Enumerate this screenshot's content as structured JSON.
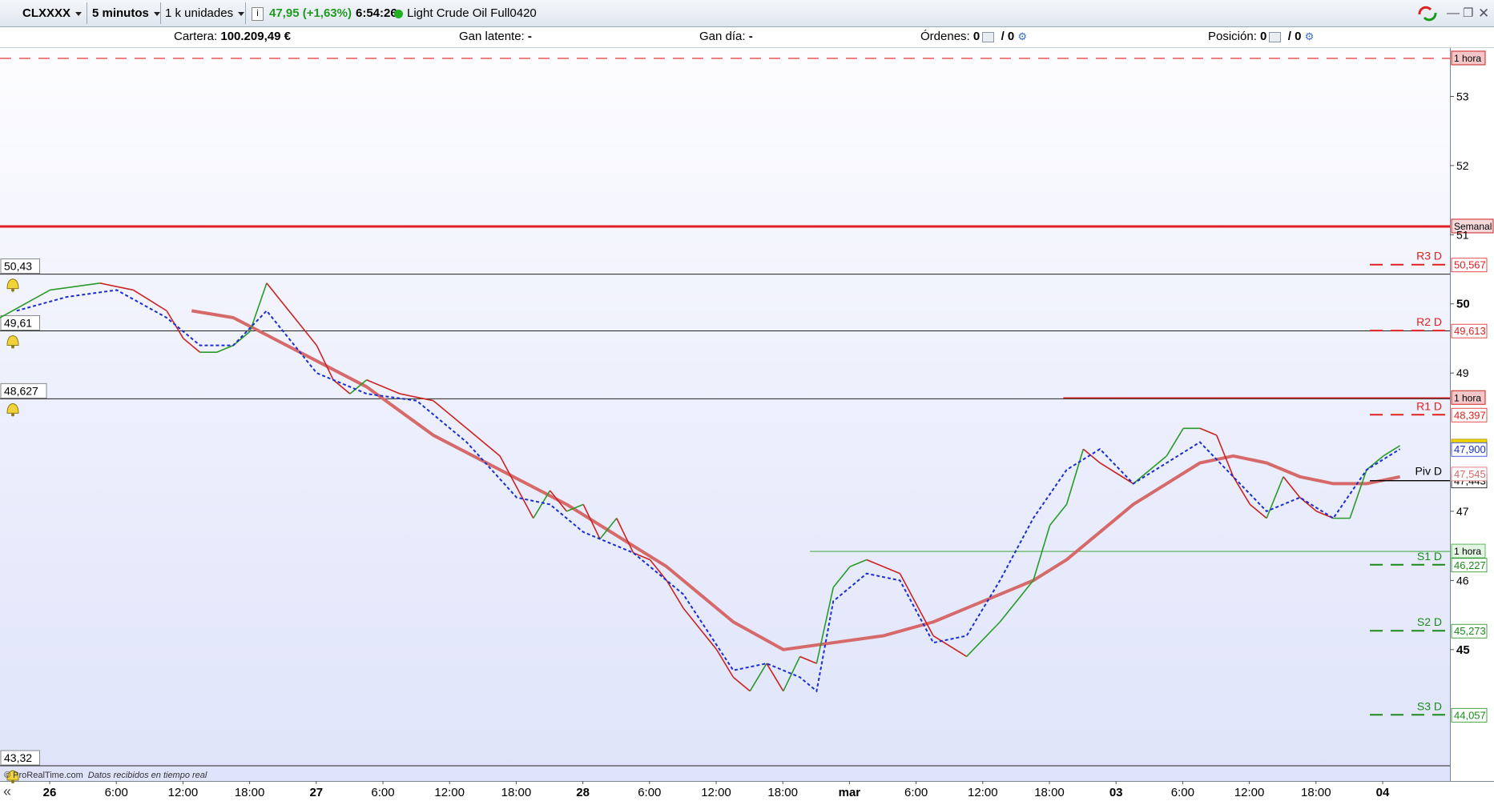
{
  "toolbar": {
    "symbol": "CLXXXX",
    "timeframe": "5 minutos",
    "units": "1 k unidades",
    "price_change": "47,95 (+1,63%)",
    "time": "6:54:26",
    "instrument": "Light Crude Oil Full0420"
  },
  "infobar": {
    "cartera_label": "Cartera:",
    "cartera_value": "100.209,49 €",
    "gan_latente_label": "Gan latente:",
    "gan_latente_value": "-",
    "gan_dia_label": "Gan día:",
    "gan_dia_value": "-",
    "ordenes_label": "Órdenes:",
    "ordenes_a": "0",
    "ordenes_b": "/ 0",
    "posicion_label": "Posición:",
    "posicion_a": "0",
    "posicion_b": "/ 0"
  },
  "footer": {
    "credit": "© ProRealTime.com",
    "credit_note": "Datos recibidos en tiempo real"
  },
  "colors": {
    "accent_red": "#e02020",
    "ma_color": "#d66a6a",
    "green": "#2a9a2a",
    "blue_dotted": "#1a2fd0",
    "last_price_bg": "#f2d600"
  },
  "chart_data": {
    "type": "line",
    "ylim": [
      43.1,
      53.7
    ],
    "y_ticks": [
      "53",
      "52",
      "51",
      "50",
      "49",
      "47",
      "46",
      "45"
    ],
    "x_ticks": [
      "26",
      "6:00",
      "12:00",
      "18:00",
      "27",
      "6:00",
      "12:00",
      "18:00",
      "28",
      "6:00",
      "12:00",
      "18:00",
      "mar",
      "6:00",
      "12:00",
      "18:00",
      "03",
      "6:00",
      "12:00",
      "18:00",
      "04"
    ],
    "price": {
      "x": [
        0,
        3,
        6,
        8,
        10,
        11,
        12,
        13,
        14,
        15,
        16,
        18,
        19,
        20,
        21,
        22,
        24,
        26,
        28,
        30,
        32,
        33,
        34,
        35,
        36,
        37,
        38,
        39,
        40,
        41,
        42,
        43,
        44,
        45,
        46,
        47,
        48,
        49,
        50,
        51,
        52,
        54,
        56,
        58,
        60,
        62,
        63,
        64,
        65,
        66,
        68,
        69,
        70,
        71,
        72,
        73,
        74,
        75,
        76,
        77,
        78,
        79,
        80,
        81,
        82,
        83,
        84
      ],
      "y": [
        49.8,
        50.2,
        50.3,
        50.2,
        49.9,
        49.5,
        49.3,
        49.3,
        49.4,
        49.6,
        50.3,
        49.7,
        49.4,
        48.9,
        48.7,
        48.9,
        48.7,
        48.6,
        48.2,
        47.8,
        46.9,
        47.3,
        47.0,
        47.1,
        46.6,
        46.9,
        46.4,
        46.3,
        46.0,
        45.6,
        45.3,
        45.0,
        44.6,
        44.4,
        44.8,
        44.4,
        44.9,
        44.8,
        45.9,
        46.2,
        46.3,
        46.1,
        45.2,
        44.9,
        45.4,
        46.0,
        46.8,
        47.1,
        47.9,
        47.7,
        47.4,
        47.6,
        47.8,
        48.2,
        48.2,
        48.1,
        47.5,
        47.1,
        46.9,
        47.5,
        47.2,
        47.0,
        46.9,
        46.9,
        47.6,
        47.8,
        47.95
      ]
    },
    "moving_average": {
      "x": [
        11.5,
        14,
        18,
        22,
        26,
        30,
        34,
        38,
        40,
        42,
        44,
        47,
        50,
        53,
        56,
        58,
        60,
        62,
        64,
        66,
        68,
        70,
        72,
        74,
        76,
        78,
        80,
        82,
        84
      ],
      "y": [
        49.9,
        49.8,
        49.3,
        48.8,
        48.1,
        47.6,
        47.1,
        46.5,
        46.2,
        45.8,
        45.4,
        45.0,
        45.1,
        45.2,
        45.4,
        45.6,
        45.8,
        46.0,
        46.3,
        46.7,
        47.1,
        47.4,
        47.7,
        47.8,
        47.7,
        47.5,
        47.4,
        47.4,
        47.5
      ]
    },
    "signal_line": {
      "x": [
        1,
        4,
        7,
        10,
        12,
        14,
        16,
        19,
        22,
        25,
        28,
        31,
        33,
        35,
        38,
        41,
        44,
        46,
        48,
        49,
        50,
        52,
        54,
        56,
        58,
        60,
        62,
        64,
        66,
        68,
        70,
        72,
        74,
        76,
        78,
        80,
        82,
        84
      ],
      "y": [
        49.9,
        50.1,
        50.2,
        49.8,
        49.4,
        49.4,
        49.9,
        49.0,
        48.7,
        48.6,
        48.0,
        47.2,
        47.1,
        46.7,
        46.4,
        45.8,
        44.7,
        44.8,
        44.6,
        44.4,
        45.7,
        46.1,
        46.0,
        45.1,
        45.2,
        46.0,
        46.9,
        47.6,
        47.9,
        47.4,
        47.7,
        48.0,
        47.5,
        47.0,
        47.2,
        46.9,
        47.6,
        47.9
      ]
    },
    "horizontal_levels": [
      {
        "value": 53.55,
        "tag": "1 hora"
      },
      {
        "value": 51.12,
        "tag": "Semanal"
      },
      {
        "value": 50.43,
        "left_label": "50,43"
      },
      {
        "value": 49.61,
        "left_label": "49,61"
      },
      {
        "value": 48.627,
        "left_label": "48,627"
      },
      {
        "value": 48.64,
        "tag": "1 hora"
      },
      {
        "value": 46.42,
        "tag": "1 hora"
      },
      {
        "value": 43.32,
        "left_label": "43,32"
      }
    ],
    "pivots": [
      {
        "name": "R3 D",
        "value": "50,567"
      },
      {
        "name": "R2 D",
        "value": "49,613"
      },
      {
        "name": "R1 D",
        "value": "48,397"
      },
      {
        "name": "Piv D",
        "value": "47,443"
      },
      {
        "name": "S1 D",
        "value": "46,227"
      },
      {
        "name": "S2 D",
        "value": "45,273"
      },
      {
        "name": "S3 D",
        "value": "44,057"
      }
    ],
    "axis_tags": [
      {
        "value": "47,95",
        "kind": "last"
      },
      {
        "value": "47,900",
        "kind": "blue"
      },
      {
        "value": "47,545",
        "kind": "ma"
      }
    ]
  }
}
